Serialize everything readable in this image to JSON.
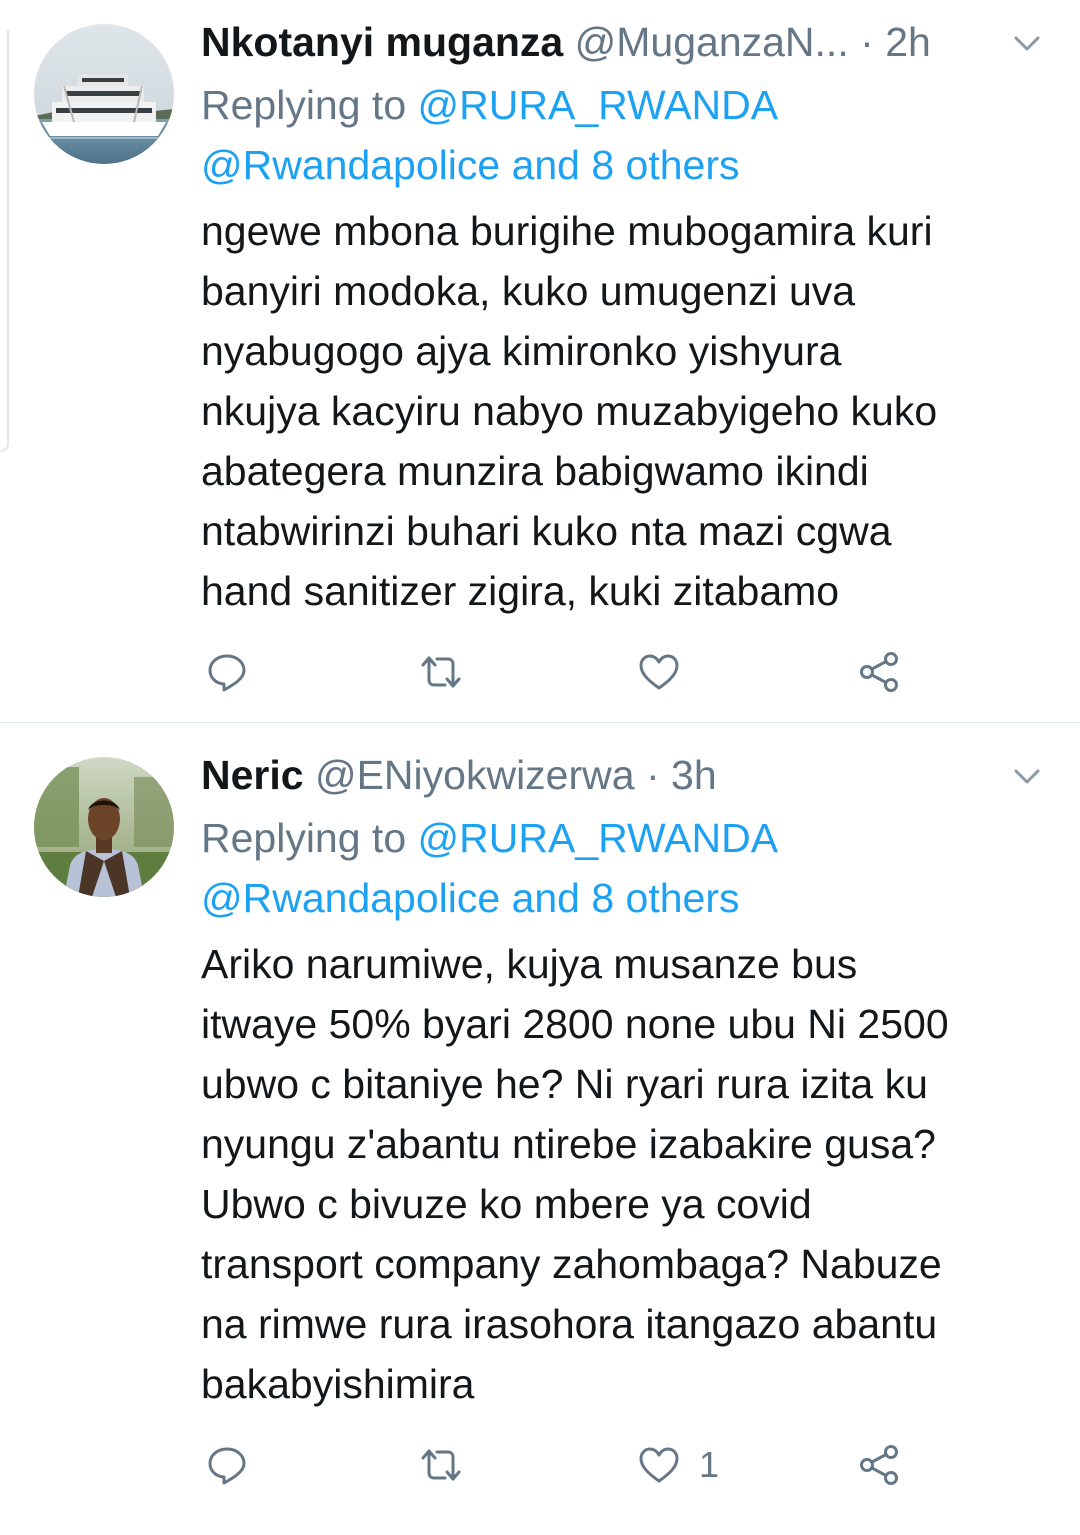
{
  "tweets": [
    {
      "display_name": "Nkotanyi muganza",
      "handle": "@MuganzaN...",
      "separator": "·",
      "time": "2h",
      "avatar_icon": "boat-avatar",
      "replying_prefix": "Replying to",
      "replying_primary": "@RURA_RWANDA",
      "replying_secondary": "@Rwandapolice and 8 others",
      "body_lines": [
        "ngewe mbona burigihe mubogamira kuri",
        "banyiri modoka, kuko umugenzi uva",
        "nyabugogo ajya kimironko yishyura",
        "nkujya kacyiru nabyo muzabyigeho kuko",
        "abategera munzira babigwamo ikindi",
        "ntabwirinzi buhari kuko nta mazi cgwa",
        "hand sanitizer zigira, kuki zitabamo"
      ],
      "like_count": ""
    },
    {
      "display_name": "Neric",
      "handle": "@ENiyokwizerwa",
      "separator": "·",
      "time": "3h",
      "avatar_icon": "person-avatar",
      "replying_prefix": "Replying to",
      "replying_primary": "@RURA_RWANDA",
      "replying_secondary": "@Rwandapolice and 8 others",
      "body_lines": [
        "Ariko narumiwe, kujya musanze bus",
        "itwaye 50% byari 2800 none ubu Ni 2500",
        "ubwo c bitaniye he? Ni ryari rura izita ku",
        "nyungu z'abantu ntirebe izabakire gusa?",
        "Ubwo c bivuze ko mbere ya covid",
        "transport company zahombaga? Nabuze",
        "na rimwe rura irasohora itangazo abantu",
        "bakabyishimira"
      ],
      "like_count": "1"
    }
  ],
  "icons": {
    "reply": "reply-icon",
    "retweet": "retweet-icon",
    "like": "heart-icon",
    "share": "share-icon",
    "more": "chevron-down-icon"
  },
  "colors": {
    "link": "#1da1f2",
    "secondary_text": "#657786",
    "primary_text": "#14171a",
    "divider": "#e1e8ed"
  }
}
